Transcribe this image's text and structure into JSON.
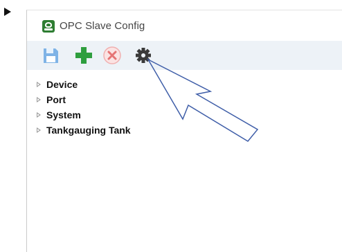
{
  "window": {
    "title": "OPC Slave Config"
  },
  "toolbar": {
    "buttons": [
      {
        "name": "save",
        "icon": "save-icon"
      },
      {
        "name": "add",
        "icon": "plus-icon"
      },
      {
        "name": "delete",
        "icon": "delete-icon"
      },
      {
        "name": "settings",
        "icon": "gear-icon"
      }
    ]
  },
  "tree": {
    "items": [
      {
        "label": "Device"
      },
      {
        "label": "Port"
      },
      {
        "label": "System"
      },
      {
        "label": "Tankgauging Tank"
      }
    ]
  },
  "colors": {
    "toolbar_bg": "#edf2f7",
    "add_green": "#2e9e3e",
    "delete_red": "#e57373",
    "save_blue": "#7fb3e6",
    "callout_arrow": "#3f5ea8"
  }
}
